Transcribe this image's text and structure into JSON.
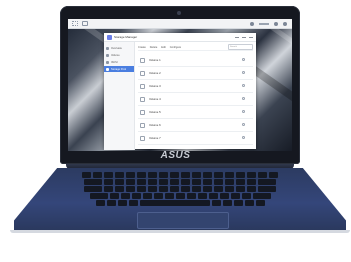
{
  "brand": {
    "logo_text": "ASUS"
  },
  "app": {
    "title": "Storage Manager"
  },
  "sidebar": {
    "items": [
      {
        "label": "Overview"
      },
      {
        "label": "Volume"
      },
      {
        "label": "iSCSI"
      },
      {
        "label": "Storage Pool"
      }
    ]
  },
  "toolbar": {
    "buttons": [
      "Create",
      "Delete",
      "Edit",
      "Configure"
    ],
    "search_placeholder": "Search"
  },
  "rows": [
    {
      "name": "Volume 1",
      "desc": ""
    },
    {
      "name": "Volume 2",
      "desc": ""
    },
    {
      "name": "Volume 3",
      "desc": ""
    },
    {
      "name": "Volume 4",
      "desc": ""
    },
    {
      "name": "Volume 5",
      "desc": ""
    },
    {
      "name": "Volume 6",
      "desc": ""
    },
    {
      "name": "Volume 7",
      "desc": ""
    }
  ]
}
